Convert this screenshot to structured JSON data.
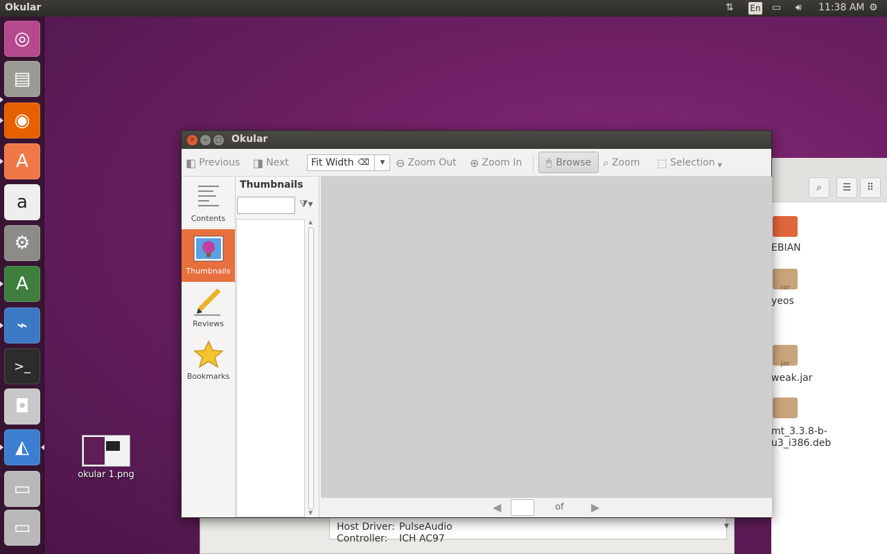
{
  "top_panel": {
    "app_name": "Okular",
    "keyboard_layout": "En",
    "time": "11:38 AM",
    "icons": [
      "network-updown-icon",
      "battery-icon",
      "volume-icon",
      "settings-gear-icon"
    ]
  },
  "launcher": {
    "items": [
      {
        "name": "ubuntu-dash",
        "glyph": "◎",
        "bg": "#b44a8d"
      },
      {
        "name": "files",
        "glyph": "▤",
        "bg": "#9c9a95"
      },
      {
        "name": "firefox",
        "glyph": "◉",
        "bg": "#e66000"
      },
      {
        "name": "software-center",
        "glyph": "A",
        "bg": "#f07746"
      },
      {
        "name": "amazon",
        "glyph": "a",
        "bg": "#eeeeee"
      },
      {
        "name": "system-settings",
        "glyph": "⚙",
        "bg": "#8d8b87"
      },
      {
        "name": "software-updater",
        "glyph": "A",
        "bg": "#3e7f3e"
      },
      {
        "name": "system-monitor",
        "glyph": "⌁",
        "bg": "#3b79c4"
      },
      {
        "name": "terminal",
        "glyph": ">_",
        "bg": "#2c2c2c"
      },
      {
        "name": "camera",
        "glyph": "◘",
        "bg": "#c8c8c8"
      },
      {
        "name": "okular",
        "glyph": "◭",
        "bg": "#3c7fd1"
      },
      {
        "name": "drive-1",
        "glyph": "▭",
        "bg": "#b8b8b8"
      },
      {
        "name": "drive-2",
        "glyph": "▭",
        "bg": "#b8b8b8"
      }
    ]
  },
  "desktop": {
    "file_label": "okular 1.png"
  },
  "files_window": {
    "items": [
      "EBIAN",
      "yeos",
      "weak.jar",
      "mt_3.3.8-b-",
      "u3_i386.deb"
    ],
    "ico_labels": [
      "rar",
      "jar"
    ]
  },
  "sound_window": {
    "row1_label": "Host Driver:",
    "row1_value": "PulseAudio",
    "row2_label": "Controller:",
    "row2_value": "ICH AC97"
  },
  "okular": {
    "title": "Okular",
    "toolbar": {
      "previous": "Previous",
      "next": "Next",
      "zoom_value": "Fit Width",
      "zoom_out": "Zoom Out",
      "zoom_in": "Zoom In",
      "browse": "Browse",
      "zoom": "Zoom",
      "selection": "Selection"
    },
    "sidebar": {
      "contents": "Contents",
      "thumbnails": "Thumbnails",
      "reviews": "Reviews",
      "bookmarks": "Bookmarks"
    },
    "panel_title": "Thumbnails",
    "search_value": "",
    "page_input": "",
    "of_label": "of"
  },
  "colors": {
    "accent": "#e8703f",
    "desktop": "#6d1f63"
  }
}
